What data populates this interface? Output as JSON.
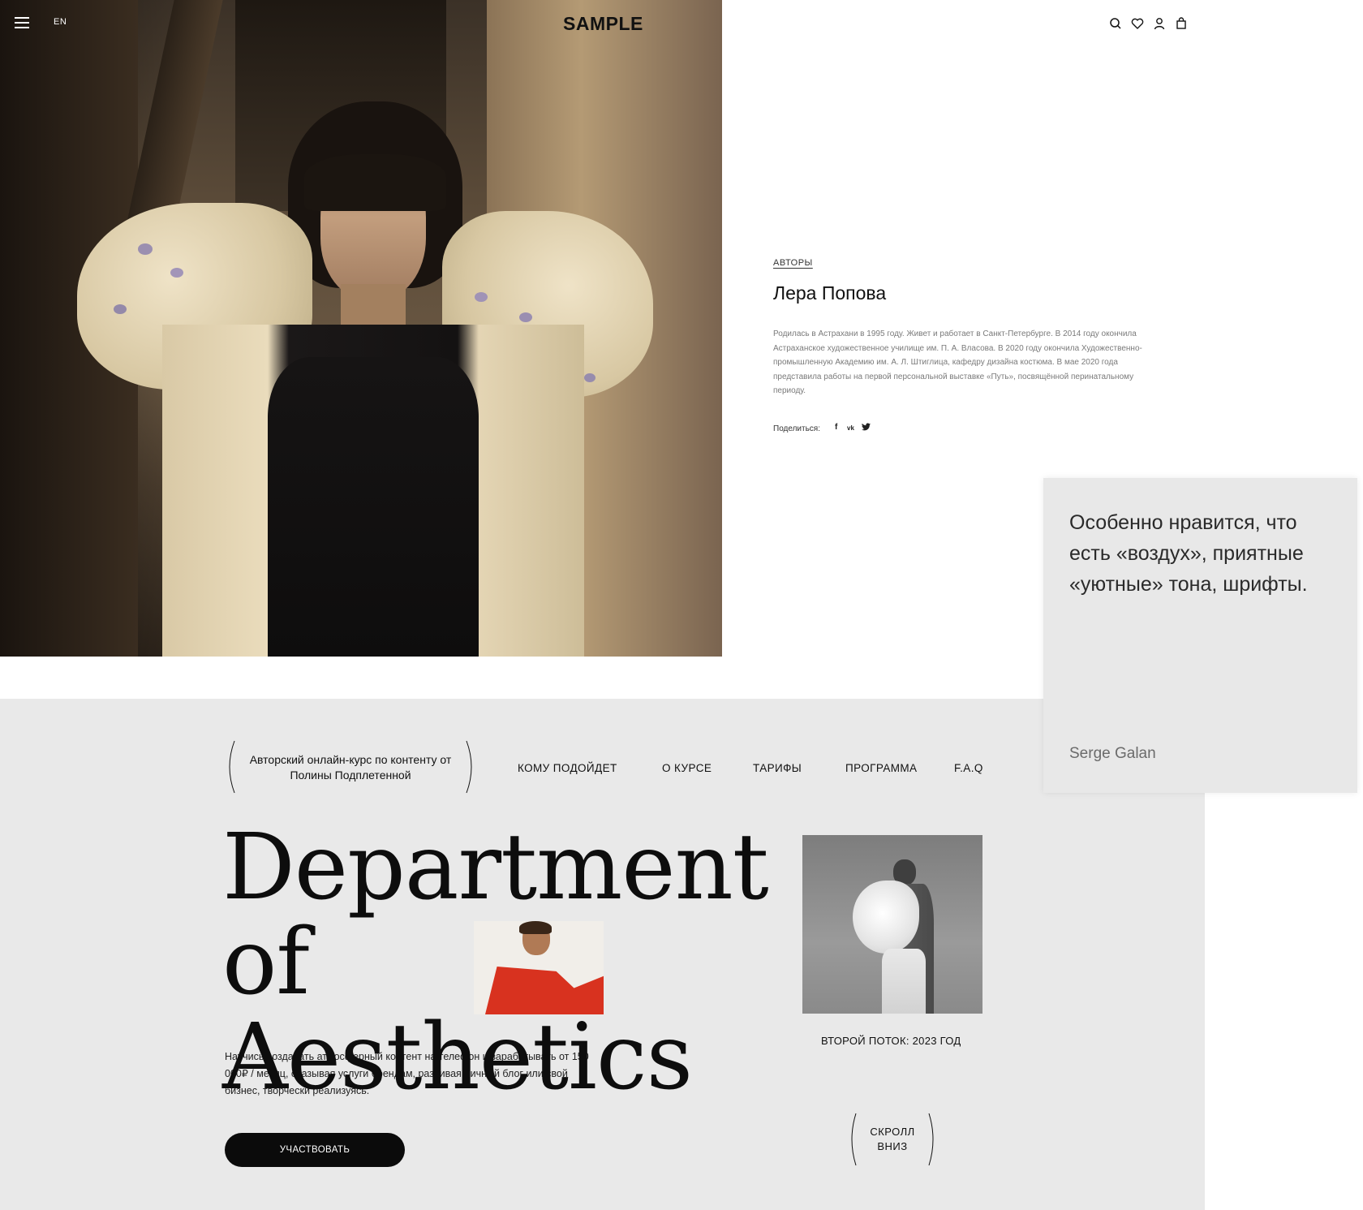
{
  "header": {
    "lang": "EN",
    "logo": "SAMPLE",
    "icons": [
      "search-icon",
      "heart-icon",
      "user-icon",
      "bag-icon"
    ]
  },
  "author": {
    "tag": "АВТОРЫ",
    "name": "Лера Попова",
    "bio": "Родилась в Астрахани в 1995 году. Живет и работает в Санкт-Петербурге. В 2014 году окончила Астраханское художественное училище им. П. А. Власова. В 2020 году окончила Художественно-промышленную Академию им. А. Л. Штиглица, кафедру дизайна костюма. В мае 2020 года представила работы на первой персональной выставке «Путь», посвящённой перинатальному периоду.",
    "share_label": "Поделиться:",
    "share_icons": [
      "f",
      "vk",
      "tw"
    ]
  },
  "testimonial": {
    "text": "Особенно нравится, что есть «воздух», приятные «уютные» тона, шрифты.",
    "author": "Serge Galan"
  },
  "course": {
    "badge": "Авторский онлайн-курс по контенту от Полины Подплетенной",
    "nav": [
      "КОМУ ПОДОЙДЕТ",
      "О КУРСЕ",
      "ТАРИФЫ",
      "ПРОГРАММА",
      "F.A.Q"
    ],
    "title_line1": "Department",
    "title_line2": "of Aesthetics",
    "stream": "ВТОРОЙ ПОТОК: 2023 ГОД",
    "description": "Научись создавать атмосферный контент на телефон и зарабатывать от 150 000₽ / месяц, оказывая услуги брендам, развивая личный блог или свой бизнес, творчески реализуясь.",
    "cta": "УЧАСТВОВАТЬ",
    "scroll": "СКРОЛЛ ВНИЗ"
  },
  "colors": {
    "page_bg": "#ffffff",
    "course_bg": "#e9e9e9",
    "card_bg": "#e8e8e8",
    "cta_bg": "#0b0b0b"
  }
}
